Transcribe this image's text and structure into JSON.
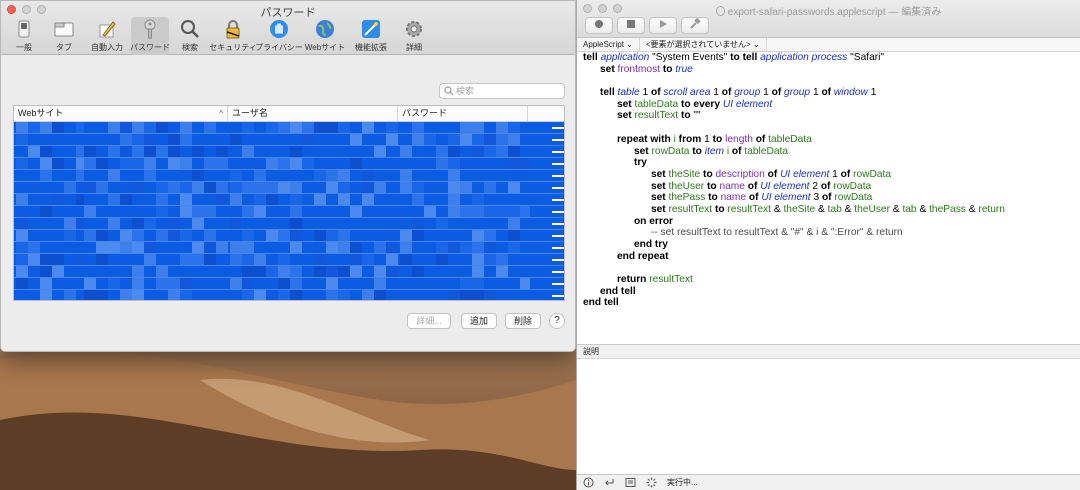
{
  "prefs": {
    "title": "パスワード",
    "toolbar": [
      {
        "label": "一般",
        "icon": "switch-icon"
      },
      {
        "label": "タブ",
        "icon": "tabs-icon"
      },
      {
        "label": "自動入力",
        "icon": "pencil-icon"
      },
      {
        "label": "パスワード",
        "icon": "key-icon"
      },
      {
        "label": "検索",
        "icon": "magnifier-icon"
      },
      {
        "label": "セキュリティ",
        "icon": "lock-icon"
      },
      {
        "label": "プライバシー",
        "icon": "hand-icon"
      },
      {
        "label": "Webサイト",
        "icon": "globe-icon"
      },
      {
        "label": "機能拡張",
        "icon": "extensions-icon"
      },
      {
        "label": "詳細",
        "icon": "gear-icon"
      }
    ],
    "search_placeholder": "検索",
    "columns": {
      "site": "Webサイト",
      "user": "ユーザ名",
      "password": "パスワード"
    },
    "buttons": {
      "details": "詳細...",
      "add": "追加",
      "remove": "削除",
      "help": "?"
    }
  },
  "editor": {
    "title": "export-safari-passwords.applescript",
    "title_suffix": "— 編集済み",
    "language": "AppleScript",
    "element_selector": "<要素が選択されていません>",
    "description_label": "説明",
    "status_text": "実行中..."
  },
  "code_lines": [
    [
      [
        "kw",
        "tell "
      ],
      [
        "cls",
        "application"
      ],
      [
        "str",
        " \"System Events\" "
      ],
      [
        "kw",
        "to tell "
      ],
      [
        "cls",
        "application process"
      ],
      [
        "str",
        " \"Safari\""
      ]
    ],
    [
      [
        "str",
        "      "
      ],
      [
        "kw",
        "set "
      ],
      [
        "prop",
        "frontmost"
      ],
      [
        "kw",
        " to "
      ],
      [
        "cls",
        "true"
      ]
    ],
    [
      [
        "str",
        ""
      ]
    ],
    [
      [
        "str",
        "      "
      ],
      [
        "kw",
        "tell "
      ],
      [
        "cls",
        "table"
      ],
      [
        "str",
        " 1 "
      ],
      [
        "kw",
        "of "
      ],
      [
        "cls",
        "scroll area"
      ],
      [
        "str",
        " 1 "
      ],
      [
        "kw",
        "of "
      ],
      [
        "cls",
        "group"
      ],
      [
        "str",
        " 1 "
      ],
      [
        "kw",
        "of "
      ],
      [
        "cls",
        "group"
      ],
      [
        "str",
        " 1 "
      ],
      [
        "kw",
        "of "
      ],
      [
        "cls",
        "window"
      ],
      [
        "str",
        " 1"
      ]
    ],
    [
      [
        "str",
        "            "
      ],
      [
        "kw",
        "set "
      ],
      [
        "var",
        "tableData"
      ],
      [
        "kw",
        " to every "
      ],
      [
        "cls",
        "UI element"
      ]
    ],
    [
      [
        "str",
        "            "
      ],
      [
        "kw",
        "set "
      ],
      [
        "var",
        "resultText"
      ],
      [
        "kw",
        " to "
      ],
      [
        "str",
        "\"\""
      ]
    ],
    [
      [
        "str",
        ""
      ]
    ],
    [
      [
        "str",
        "            "
      ],
      [
        "kw",
        "repeat with "
      ],
      [
        "var",
        "i"
      ],
      [
        "kw",
        " from "
      ],
      [
        "str",
        "1 "
      ],
      [
        "kw",
        "to "
      ],
      [
        "prop",
        "length"
      ],
      [
        "kw",
        " of "
      ],
      [
        "var",
        "tableData"
      ]
    ],
    [
      [
        "str",
        "                  "
      ],
      [
        "kw",
        "set "
      ],
      [
        "var",
        "rowData"
      ],
      [
        "kw",
        " to "
      ],
      [
        "cls",
        "item"
      ],
      [
        "str",
        " "
      ],
      [
        "var",
        "i"
      ],
      [
        "kw",
        " of "
      ],
      [
        "var",
        "tableData"
      ]
    ],
    [
      [
        "str",
        "                  "
      ],
      [
        "kw",
        "try"
      ]
    ],
    [
      [
        "str",
        "                        "
      ],
      [
        "kw",
        "set "
      ],
      [
        "var",
        "theSite"
      ],
      [
        "kw",
        " to "
      ],
      [
        "prop",
        "description"
      ],
      [
        "kw",
        " of "
      ],
      [
        "cls",
        "UI element"
      ],
      [
        "str",
        " 1 "
      ],
      [
        "kw",
        "of "
      ],
      [
        "var",
        "rowData"
      ]
    ],
    [
      [
        "str",
        "                        "
      ],
      [
        "kw",
        "set "
      ],
      [
        "var",
        "theUser"
      ],
      [
        "kw",
        " to "
      ],
      [
        "prop",
        "name"
      ],
      [
        "kw",
        " of "
      ],
      [
        "cls",
        "UI element"
      ],
      [
        "str",
        " 2 "
      ],
      [
        "kw",
        "of "
      ],
      [
        "var",
        "rowData"
      ]
    ],
    [
      [
        "str",
        "                        "
      ],
      [
        "kw",
        "set "
      ],
      [
        "var",
        "thePass"
      ],
      [
        "kw",
        " to "
      ],
      [
        "prop",
        "name"
      ],
      [
        "kw",
        " of "
      ],
      [
        "cls",
        "UI element"
      ],
      [
        "str",
        " 3 "
      ],
      [
        "kw",
        "of "
      ],
      [
        "var",
        "rowData"
      ]
    ],
    [
      [
        "str",
        "                        "
      ],
      [
        "kw",
        "set "
      ],
      [
        "var",
        "resultText"
      ],
      [
        "kw",
        " to "
      ],
      [
        "var",
        "resultText"
      ],
      [
        "str",
        " & "
      ],
      [
        "var",
        "theSite"
      ],
      [
        "str",
        " & "
      ],
      [
        "var",
        "tab"
      ],
      [
        "str",
        " & "
      ],
      [
        "var",
        "theUser"
      ],
      [
        "str",
        " & "
      ],
      [
        "var",
        "tab"
      ],
      [
        "str",
        " & "
      ],
      [
        "var",
        "thePass"
      ],
      [
        "str",
        " & "
      ],
      [
        "var",
        "return"
      ]
    ],
    [
      [
        "str",
        "                  "
      ],
      [
        "kw",
        "on error"
      ]
    ],
    [
      [
        "str",
        "                        "
      ],
      [
        "cmt",
        "-- set resultText to resultText & \"#\" & i & \":Error\" & return"
      ]
    ],
    [
      [
        "str",
        "                  "
      ],
      [
        "kw",
        "end try"
      ]
    ],
    [
      [
        "str",
        "            "
      ],
      [
        "kw",
        "end repeat"
      ]
    ],
    [
      [
        "str",
        ""
      ]
    ],
    [
      [
        "str",
        "            "
      ],
      [
        "kw",
        "return "
      ],
      [
        "var",
        "resultText"
      ]
    ],
    [
      [
        "str",
        "      "
      ],
      [
        "kw",
        "end tell"
      ]
    ],
    [
      [
        "kw",
        "end tell"
      ]
    ]
  ]
}
